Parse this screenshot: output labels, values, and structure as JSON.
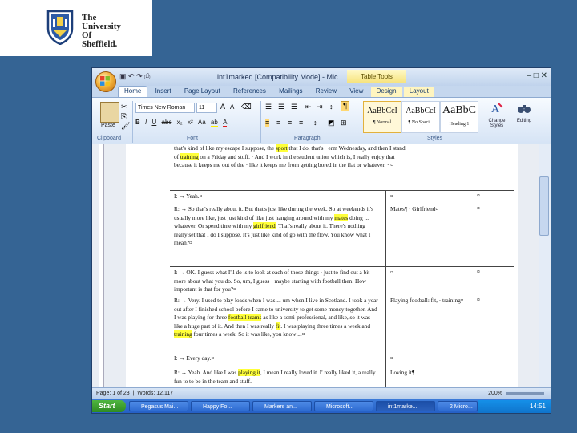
{
  "logo": {
    "lines": [
      "The",
      "University",
      "Of",
      "Sheffield."
    ]
  },
  "window": {
    "title": "int1marked [Compatibility Mode] - Mic...",
    "context_tab": "Table Tools"
  },
  "ribbon_tabs": [
    "Home",
    "Insert",
    "Page Layout",
    "References",
    "Mailings",
    "Review",
    "View",
    "Design",
    "Layout"
  ],
  "ribbon": {
    "paste": "Paste",
    "font_name": "Times New Roman",
    "font_size": "11",
    "groups": [
      "Clipboard",
      "Font",
      "Paragraph",
      "Styles"
    ],
    "styles": [
      {
        "preview": "AaBbCcI",
        "label": "¶ Normal"
      },
      {
        "preview": "AaBbCcI",
        "label": "¶ No Spaci..."
      },
      {
        "preview": "AaBbC",
        "label": "Heading 1"
      }
    ],
    "change_styles": "Change Styles",
    "editing": "Editing"
  },
  "document": {
    "intro": "that's kind of like my escape I suppose, the sport that I do, that's · erm Wednesday, and then I stand of training on a Friday and stuff. · And I work in the student union which is, I really enjoy that · because it keeps me out of the · like it keeps me from getting bored in the flat or whatever. · ¤",
    "rows": [
      {
        "turn": "I: → Yeah.¤",
        "code": "¤"
      },
      {
        "turn": "R: → So that's really about it. But that's just like during the week. So at weekends it's usually more like, just just kind of like just hanging around with my mates doing ... whatever. Or spend time with my girlfriend. That's really about it. There's nothing really set that I do I suppose. It's just like kind of go with the flow. You know what I mean?¤",
        "code": "Mates¶ · Girlfriend¤"
      },
      {
        "turn": "I: → OK. I guess what I'll do is to look at each of those things · just to find out a bit more about what you do. So, um, I guess · maybe starting with football then. How important is that for you?¤",
        "code": "¤"
      },
      {
        "turn": "R: → Very. I used to play loads when I was ... um when I live in Scotland. I took a year out after I finished school before I came to university to get some money together. And I was playing for three football teams as like a semi-professional, and like, so it was like a huge part of it. And then I was really fit. I was playing three times a week and training four times a week. So it was like, you know ...¤",
        "code": "Playing football: fit, · training¤"
      },
      {
        "turn": "I: → Every day.¤",
        "code": "¤"
      },
      {
        "turn": "R: → Yeah. And like I was playing it, I mean I really loved it. I' really liked it, a really fun to to be in the team and stuff.",
        "code": "Loving it¶"
      }
    ]
  },
  "status": {
    "page": "Page: 1 of 23",
    "words": "Words: 12,117",
    "zoom": "200%"
  },
  "taskbar": {
    "start": "Start",
    "tasks": [
      "Pegasus Mai...",
      "Happy Fo...",
      "Markers an...",
      "Microsoft...",
      "int1marke...",
      "2 Micro..."
    ],
    "clock": "14:51"
  }
}
